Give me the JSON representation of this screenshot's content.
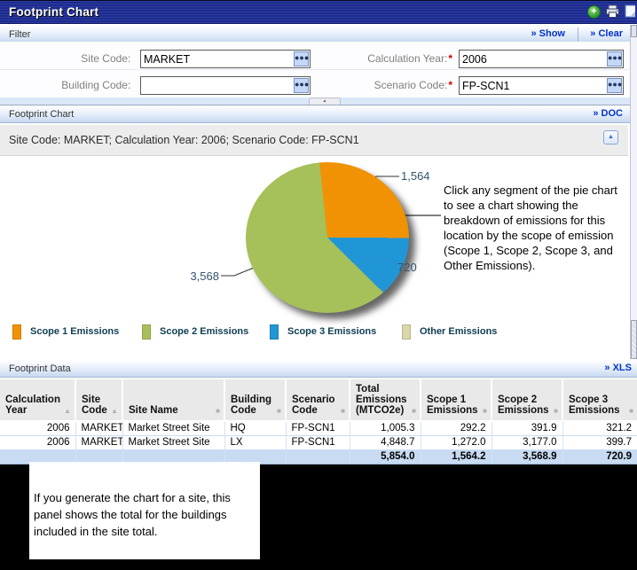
{
  "title_bar": {
    "title": "Footprint Chart",
    "icons": [
      "add-icon",
      "print-icon",
      "export-icon"
    ]
  },
  "filter": {
    "header": "Filter",
    "show_label": "» Show",
    "clear_label": "» Clear",
    "fields": [
      {
        "label": "Site Code:",
        "value": "MARKET",
        "required": false
      },
      {
        "label": "Building Code:",
        "value": "",
        "required": false
      },
      {
        "label": "Calculation Year:",
        "value": "2006",
        "required": true
      },
      {
        "label": "Scenario Code:",
        "value": "FP-SCN1",
        "required": true
      }
    ]
  },
  "chart_section": {
    "header": "Footprint Chart",
    "doc_label": "» DOC",
    "context": "Site Code: MARKET; Calculation Year: 2006; Scenario Code: FP-SCN1",
    "annotation": "Click any segment of the pie chart to see a chart showing the breakdown of emissions for this location by the scope of emission (Scope 1, Scope 2, Scope 3, and Other Emissions)."
  },
  "chart_data": {
    "type": "pie",
    "start_angle_deg": -6,
    "slices": [
      {
        "label": "Scope 1 Emissions",
        "value": 1564,
        "display": "1,564",
        "color": "#F19204"
      },
      {
        "label": "Scope 3 Emissions",
        "value": 720,
        "display": "720",
        "color": "#2196D6"
      },
      {
        "label": "Scope 2 Emissions",
        "value": 3568,
        "display": "3,568",
        "color": "#A6C05A"
      }
    ],
    "legend": [
      {
        "label": "Scope 1 Emissions",
        "color": "#F19204"
      },
      {
        "label": "Scope 2 Emissions",
        "color": "#A6C05A"
      },
      {
        "label": "Scope 3 Emissions",
        "color": "#2196D6"
      },
      {
        "label": "Other Emissions",
        "color": "#D8D8A8"
      }
    ],
    "legend_position": "bottom"
  },
  "data_section": {
    "header": "Footprint Data",
    "xls_label": "» XLS",
    "table": {
      "columns": [
        {
          "label": "Calculation Year",
          "sort": "asc"
        },
        {
          "label": "Site Code",
          "sort": "asc"
        },
        {
          "label": "Site Name",
          "sort": "none"
        },
        {
          "label": "Building Code",
          "sort": "none"
        },
        {
          "label": "Scenario Code",
          "sort": "none"
        },
        {
          "label": "Total Emissions (MTCO2e)",
          "sort": "none"
        },
        {
          "label": "Scope 1 Emissions",
          "sort": "none"
        },
        {
          "label": "Scope 2 Emissions",
          "sort": "none"
        },
        {
          "label": "Scope 3 Emissions",
          "sort": "none"
        }
      ],
      "rows": [
        [
          "2006",
          "MARKET",
          "Market Street Site",
          "HQ",
          "FP-SCN1",
          "1,005.3",
          "292.2",
          "391.9",
          "321.2"
        ],
        [
          "2006",
          "MARKET",
          "Market Street Site",
          "LX",
          "FP-SCN1",
          "4,848.7",
          "1,272.0",
          "3,177.0",
          "399.7"
        ]
      ],
      "total_row": [
        "",
        "",
        "",
        "",
        "",
        "5,854.0",
        "1,564.2",
        "3,568.9",
        "720.9"
      ]
    }
  },
  "note_panel": {
    "text": "If you generate the chart for a site, this panel shows the total for the buildings included in the site total."
  }
}
